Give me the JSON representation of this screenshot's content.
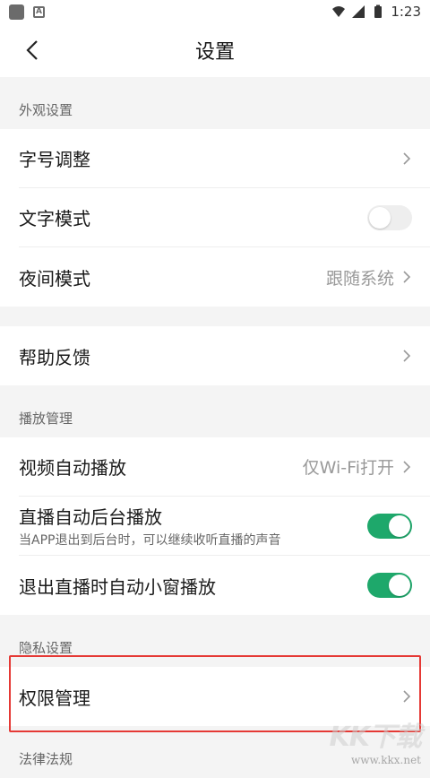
{
  "status_bar": {
    "time": "1:23"
  },
  "header": {
    "title": "设置"
  },
  "sections": {
    "appearance": {
      "title": "外观设置"
    },
    "playback": {
      "title": "播放管理"
    },
    "privacy": {
      "title": "隐私设置"
    },
    "legal": {
      "title": "法律法规"
    }
  },
  "rows": {
    "font_size": {
      "label": "字号调整"
    },
    "text_mode": {
      "label": "文字模式",
      "enabled": false
    },
    "night_mode": {
      "label": "夜间模式",
      "value": "跟随系统"
    },
    "help": {
      "label": "帮助反馈"
    },
    "autoplay": {
      "label": "视频自动播放",
      "value": "仅Wi-Fi打开"
    },
    "bg_live": {
      "label": "直播自动后台播放",
      "sub": "当APP退出到后台时，可以继续收听直播的声音",
      "enabled": true
    },
    "pip": {
      "label": "退出直播时自动小窗播放",
      "enabled": true
    },
    "permissions": {
      "label": "权限管理"
    }
  },
  "watermark": {
    "logo_text": "KK下载",
    "url": "www.kkx.net"
  },
  "colors": {
    "toggle_on": "#1ea86b",
    "highlight": "#e53935"
  }
}
